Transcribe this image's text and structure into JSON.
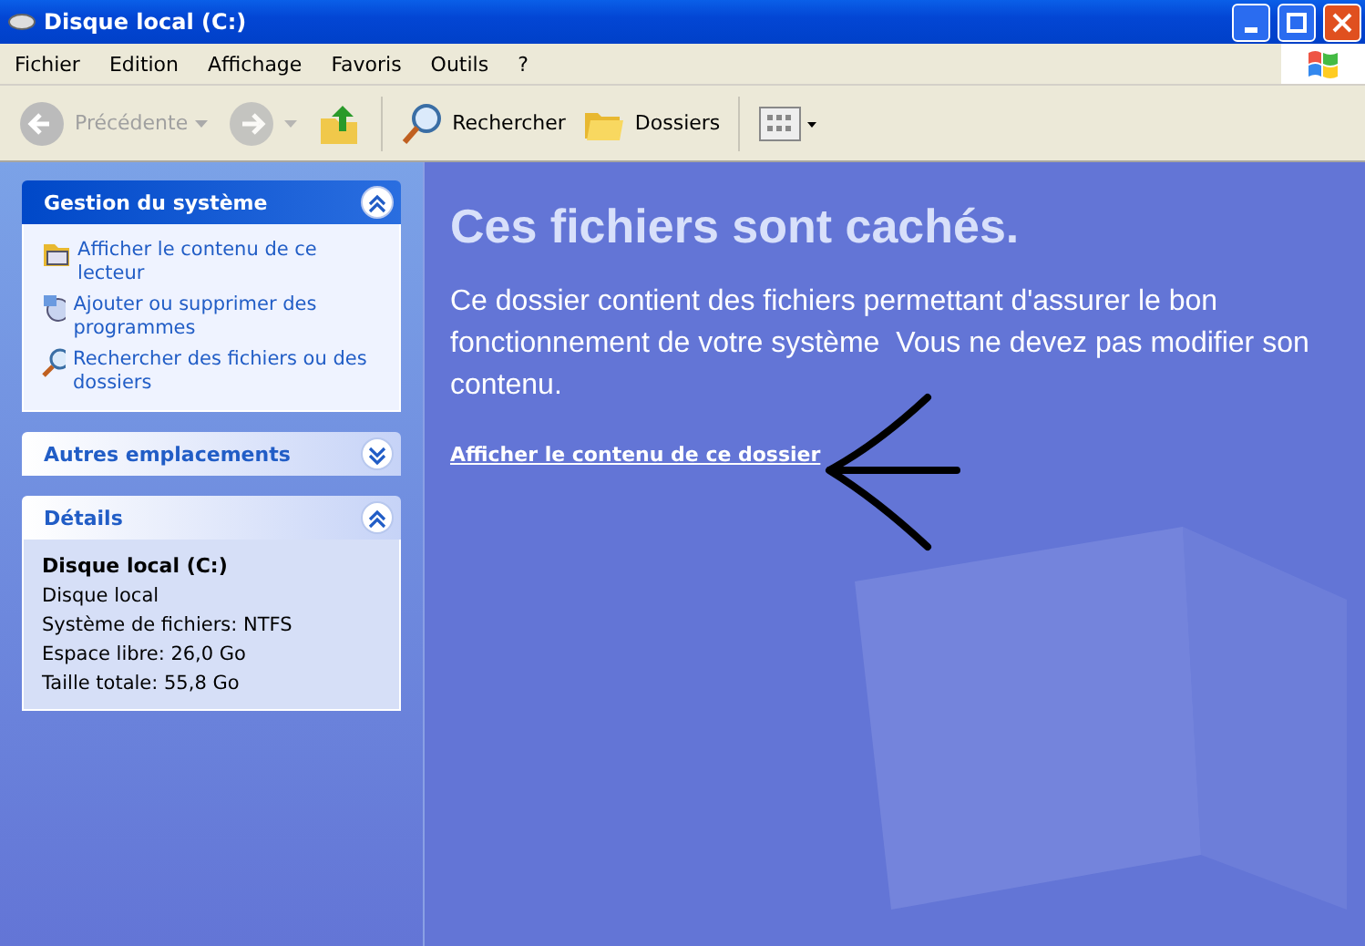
{
  "window": {
    "title": "Disque local (C:)"
  },
  "menu": [
    "Fichier",
    "Edition",
    "Affichage",
    "Favoris",
    "Outils",
    "?"
  ],
  "toolbar": [
    {
      "kind": "back",
      "label": "Précédente",
      "disabled": true
    },
    {
      "kind": "forward",
      "disabled": true
    },
    {
      "kind": "up",
      "disabled": false
    },
    {
      "kind": "search",
      "label": "Rechercher",
      "disabled": false
    },
    {
      "kind": "folders",
      "label": "Dossiers",
      "disabled": false
    },
    {
      "kind": "views",
      "disabled": false
    }
  ],
  "panels": [
    {
      "title": "Gestion du système",
      "kind": "tasks",
      "expanded": true,
      "items": [
        {
          "label": "Afficher le contenu de ce lecteur"
        },
        {
          "label": "Ajouter ou supprimer des programmes"
        },
        {
          "label": "Rechercher des fichiers ou des dossiers"
        }
      ]
    },
    {
      "title": "Autres emplacements",
      "kind": "tasks",
      "expanded": false
    },
    {
      "title": "Détails",
      "kind": "details",
      "expanded": true,
      "name": "Disque local (C:)",
      "lines": [
        "Disque local",
        "Système de fichiers: NTFS",
        "Espace libre: 26,0 Go",
        "Taille totale: 55,8 Go"
      ]
    }
  ],
  "main": {
    "heading": "Ces fichiers sont cachés.",
    "body": "Ce dossier contient des fichiers permettant d'assurer le bon fonctionnement de votre système  Vous ne devez pas modifier son contenu.",
    "link": "Afficher le contenu de ce dossier"
  }
}
